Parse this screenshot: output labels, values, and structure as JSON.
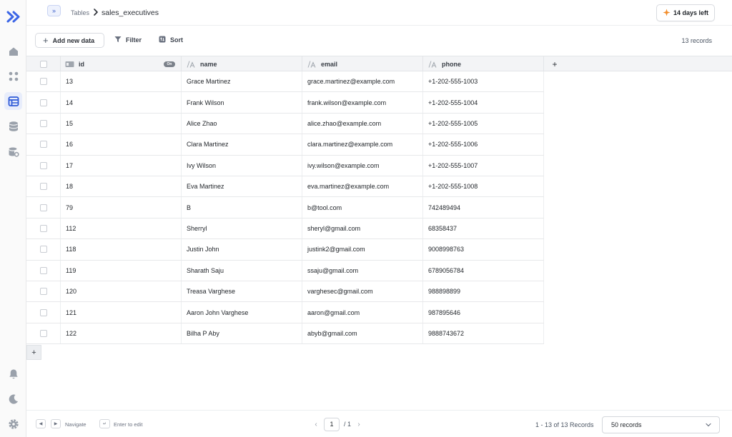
{
  "header": {
    "breadcrumb_root": "Tables",
    "breadcrumb_current": "sales_executives",
    "expand_label": "»",
    "trial_label": "14 days left"
  },
  "toolbar": {
    "add_label": "Add new data",
    "filter_label": "Filter",
    "sort_label": "Sort",
    "records_count": "13 records"
  },
  "table": {
    "columns": [
      {
        "key": "id",
        "label": "id",
        "type_icon": "id-type-icon",
        "badge": "On"
      },
      {
        "key": "name",
        "label": "name",
        "type_icon": "text-type-icon"
      },
      {
        "key": "email",
        "label": "email",
        "type_icon": "text-type-icon"
      },
      {
        "key": "phone",
        "label": "phone",
        "type_icon": "text-type-icon"
      }
    ],
    "add_column_label": "+",
    "add_row_label": "+",
    "rows": [
      {
        "id": "13",
        "name": "Grace Martinez",
        "email": "grace.martinez@example.com",
        "phone": "+1-202-555-1003"
      },
      {
        "id": "14",
        "name": "Frank Wilson",
        "email": "frank.wilson@example.com",
        "phone": "+1-202-555-1004"
      },
      {
        "id": "15",
        "name": "Alice Zhao",
        "email": "alice.zhao@example.com",
        "phone": "+1-202-555-1005"
      },
      {
        "id": "16",
        "name": "Clara Martinez",
        "email": "clara.martinez@example.com",
        "phone": "+1-202-555-1006"
      },
      {
        "id": "17",
        "name": "Ivy Wilson",
        "email": "ivy.wilson@example.com",
        "phone": "+1-202-555-1007"
      },
      {
        "id": "18",
        "name": "Eva Martinez",
        "email": "eva.martinez@example.com",
        "phone": "+1-202-555-1008"
      },
      {
        "id": "79",
        "name": "B",
        "email": "b@tool.com",
        "phone": "742489494"
      },
      {
        "id": "112",
        "name": "Sherryl",
        "email": "sheryl@gmail.com",
        "phone": "68358437"
      },
      {
        "id": "118",
        "name": "Justin John",
        "email": "justink2@gmail.com",
        "phone": "9008998763"
      },
      {
        "id": "119",
        "name": "Sharath Saju",
        "email": "ssaju@gmail.com",
        "phone": "6789056784"
      },
      {
        "id": "120",
        "name": "Treasa Varghese",
        "email": "varghesec@gmail.com",
        "phone": "988898899"
      },
      {
        "id": "121",
        "name": "Aaron John Varghese",
        "email": "aaron@gmail.com",
        "phone": "987895646"
      },
      {
        "id": "122",
        "name": "Bilha P Aby",
        "email": "abyb@gmail.com",
        "phone": "9888743672"
      }
    ]
  },
  "footer": {
    "nav_hint": "Navigate",
    "edit_hint": "Enter to edit",
    "page_current": "1",
    "page_total": "/ 1",
    "range_text": "1 - 13 of 13 Records",
    "page_size": "50 records"
  },
  "sidebar": {
    "icons": [
      "logo-icon",
      "home-icon",
      "apps-icon",
      "tables-icon",
      "database-icon",
      "storage-settings-icon",
      "bell-icon",
      "moon-icon",
      "settings-icon"
    ],
    "active": "tables-icon"
  },
  "colors": {
    "accent": "#2f5bd8",
    "trial_star": "#f28c28"
  }
}
